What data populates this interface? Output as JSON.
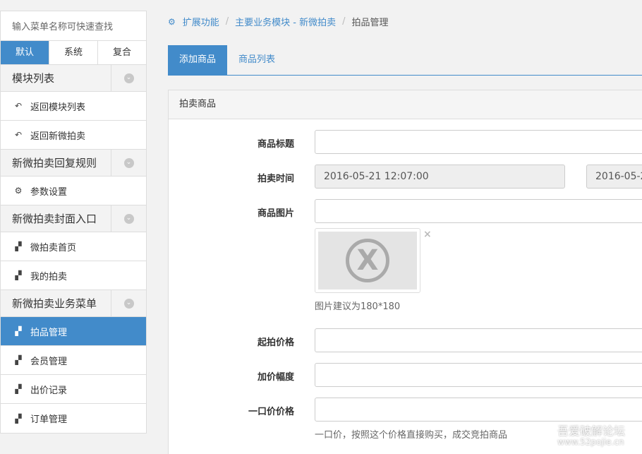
{
  "sidebar": {
    "search_placeholder": "输入菜单名称可快速查找",
    "tabs": [
      "默认",
      "系统",
      "复合"
    ],
    "groups": [
      {
        "title": "模块列表",
        "items": [
          "返回模块列表",
          "返回新微拍卖"
        ]
      },
      {
        "title": "新微拍卖回复规则",
        "items": [
          "参数设置"
        ]
      },
      {
        "title": "新微拍卖封面入口",
        "items": [
          "微拍卖首页",
          "我的拍卖"
        ]
      },
      {
        "title": "新微拍卖业务菜单",
        "items": [
          "拍品管理",
          "会员管理",
          "出价记录",
          "订单管理"
        ]
      }
    ],
    "active_item": "拍品管理"
  },
  "breadcrumb": {
    "items": [
      "扩展功能",
      "主要业务模块 - 新微拍卖",
      "拍品管理"
    ],
    "separator": "/"
  },
  "tabs": {
    "items": [
      "添加商品",
      "商品列表"
    ]
  },
  "panel": {
    "title": "拍卖商品",
    "labels": {
      "title": "商品标题",
      "time": "拍卖时间",
      "image": "商品图片",
      "start_price": "起拍价格",
      "increment": "加价幅度",
      "buyout": "一口价价格"
    },
    "time_start": "2016-05-21 12:07:00",
    "time_end": "2016-05-2",
    "image_help": "图片建议为180*180",
    "buyout_help": "一口价，按照这个价格直接购买，成交竞拍商品",
    "remove_glyph": "×"
  },
  "watermark": {
    "line1": "吾爱破解论坛",
    "line2": "www.52pojie.cn"
  },
  "colors": {
    "accent": "#428bca",
    "page_bg": "#f2f2f2"
  },
  "icons": {
    "breadcrumb": "cogs-icon",
    "back": "reply-icon",
    "settings": "gear-icon",
    "module": "puzzle-icon",
    "toggle": "chevron-down-circle-icon"
  }
}
